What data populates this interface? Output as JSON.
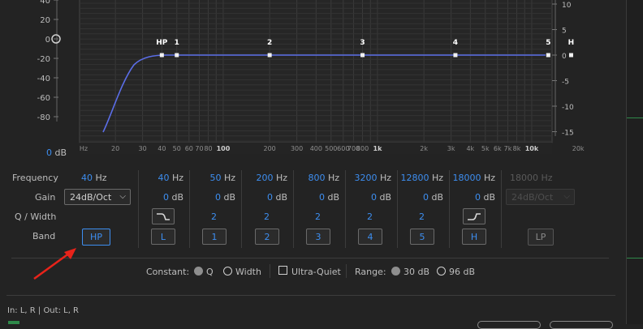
{
  "graph": {
    "db_ticks": [
      "40",
      "20",
      "0",
      "-20",
      "-40",
      "-60",
      "-80"
    ],
    "right_ticks": [
      "10",
      "5",
      "0",
      "-5",
      "-10",
      "-15"
    ],
    "freq_labels": [
      "Hz",
      "20",
      "30",
      "40",
      "50",
      "60",
      "70",
      "80",
      "100",
      "200",
      "300",
      "400",
      "500",
      "600",
      "700",
      "800",
      "1k",
      "2k",
      "3k",
      "4k",
      "5k",
      "6k",
      "7k",
      "8k",
      "10k",
      "20k"
    ],
    "gain_readout_value": "0",
    "gain_readout_unit": "dB",
    "curve_color": "#5b6ee8",
    "node_labels": [
      "HP",
      "1",
      "2",
      "3",
      "4",
      "5",
      "H"
    ]
  },
  "rows": {
    "frequency_label": "Frequency",
    "gain_label": "Gain",
    "q_label": "Q / Width",
    "band_label": "Band"
  },
  "hp_column": {
    "freq": "40",
    "freq_unit": "Hz",
    "slope": "24dB/Oct",
    "band": "HP"
  },
  "bands": [
    {
      "freq": "40",
      "unit": "Hz",
      "gain": "0",
      "gain_unit": "dB",
      "q_icon": "low-shelf-icon",
      "band": "L"
    },
    {
      "freq": "50",
      "unit": "Hz",
      "gain": "0",
      "gain_unit": "dB",
      "q": "2",
      "band": "1"
    },
    {
      "freq": "200",
      "unit": "Hz",
      "gain": "0",
      "gain_unit": "dB",
      "q": "2",
      "band": "2"
    },
    {
      "freq": "800",
      "unit": "Hz",
      "gain": "0",
      "gain_unit": "dB",
      "q": "2",
      "band": "3"
    },
    {
      "freq": "3200",
      "unit": "Hz",
      "gain": "0",
      "gain_unit": "dB",
      "q": "2",
      "band": "4"
    },
    {
      "freq": "12800",
      "unit": "Hz",
      "gain": "0",
      "gain_unit": "dB",
      "q": "2",
      "band": "5"
    },
    {
      "freq": "18000",
      "unit": "Hz",
      "gain": "0",
      "gain_unit": "dB",
      "q_icon": "high-shelf-icon",
      "band": "H"
    }
  ],
  "lp_column": {
    "freq": "18000",
    "freq_unit": "Hz",
    "slope": "24dB/Oct",
    "band": "LP"
  },
  "options": {
    "constant_label": "Constant:",
    "q_option": "Q",
    "width_option": "Width",
    "ultra_quiet": "Ultra-Quiet",
    "range_label": "Range:",
    "range_30": "30 dB",
    "range_96": "96 dB"
  },
  "footer": {
    "io": "In: L, R | Out: L, R"
  },
  "accent": "#3d8ef0",
  "arrow_color": "#e8231a"
}
